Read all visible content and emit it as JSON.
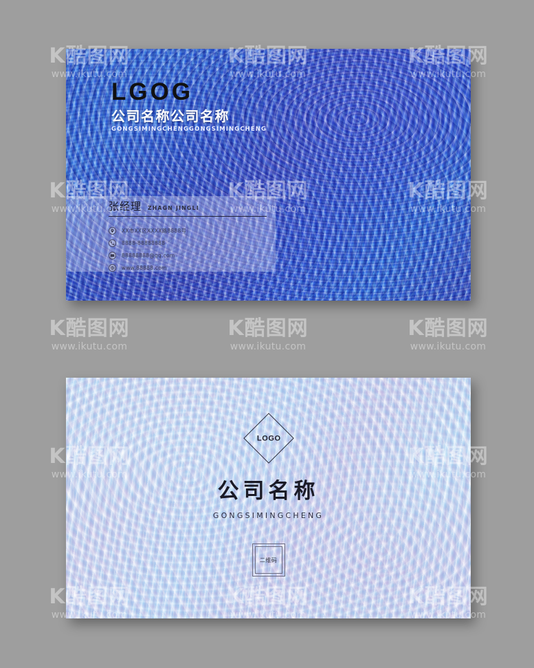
{
  "background_color": "#9e9e9e",
  "watermark": {
    "logo_text": "K酷图网",
    "url": "www.ikutu.com"
  },
  "front_card": {
    "logo_text": "LGOG",
    "company_name_cn": "公司名称公司名称",
    "company_name_pinyin": "GONGSIMINGCHENGGONGSIMINGCHENG",
    "person_name_cn": "张经理",
    "person_name_pinyin": "ZHAGN JINGLI",
    "contacts": [
      {
        "icon": "location-pin-icon",
        "text": "XX市XX区XXXX路8888号"
      },
      {
        "icon": "phone-icon",
        "text": "8888-88888888"
      },
      {
        "icon": "email-icon",
        "text": "88888888@qq.com"
      },
      {
        "icon": "website-icon",
        "text": "www.88888.com"
      }
    ]
  },
  "back_card": {
    "logo_text": "LOGO",
    "company_name_cn": "公司名称",
    "company_name_pinyin": "GONGSIMINGCHENG",
    "qr_label": "二维码"
  },
  "colors": {
    "front_marble_primary": "#2350d8",
    "front_marble_secondary": "#1b74e4",
    "back_marble_primary": "#c8e4fa",
    "back_marble_secondary": "#cfc9ea",
    "text_dark": "#1a1a26",
    "text_light": "#ffffff"
  }
}
